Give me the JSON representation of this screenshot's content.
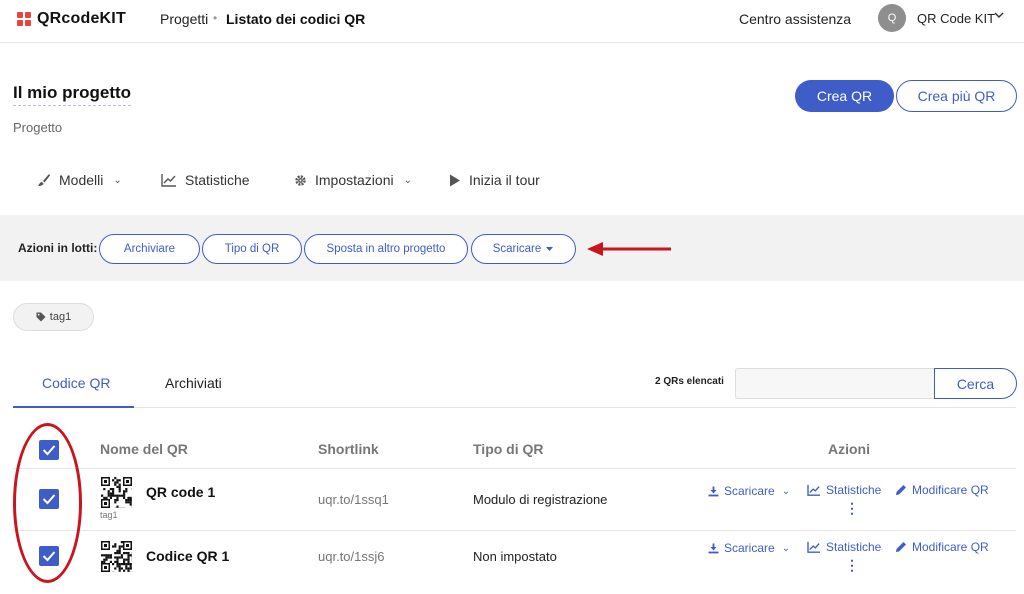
{
  "header": {
    "logo_text": "QRcodeKIT",
    "breadcrumb_projects": "Progetti",
    "breadcrumb_separator": "•",
    "breadcrumb_current": "Listato dei codici QR",
    "help_center": "Centro assistenza",
    "avatar_initial": "Q",
    "account_name": "QR Code KIT"
  },
  "project": {
    "title": "Il mio progetto",
    "subtitle": "Progetto",
    "create_button": "Crea QR",
    "create_many_button": "Crea più QR"
  },
  "subnav": {
    "templates": "Modelli",
    "statistics": "Statistiche",
    "settings": "Impostazioni",
    "tour": "Inizia il tour"
  },
  "batch": {
    "label": "Azioni in lotti:",
    "archive": "Archiviare",
    "qr_type": "Tipo di QR",
    "move": "Sposta in altro progetto",
    "download": "Scaricare"
  },
  "tag_filter": "tag1",
  "tabs": {
    "codes": "Codice QR",
    "archived": "Archiviati"
  },
  "list_count": "2 QRs elencati",
  "search": {
    "value": "",
    "button": "Cerca"
  },
  "table": {
    "headers": {
      "name": "Nome del QR",
      "shortlink": "Shortlink",
      "type": "Tipo di QR",
      "actions": "Azioni"
    },
    "rows": [
      {
        "name": "QR code 1",
        "tag": "tag1",
        "shortlink": "uqr.to/1ssq1",
        "type": "Modulo di registrazione",
        "checked": true
      },
      {
        "name": "Codice QR 1",
        "tag": "",
        "shortlink": "uqr.to/1ssj6",
        "type": "Non impostato",
        "checked": true
      }
    ],
    "action_labels": {
      "download": "Scaricare",
      "statistics": "Statistiche",
      "edit": "Modificare QR"
    }
  },
  "colors": {
    "accent": "#3f5dc9",
    "annotation": "#c9151e",
    "logo": "#e8443a"
  }
}
